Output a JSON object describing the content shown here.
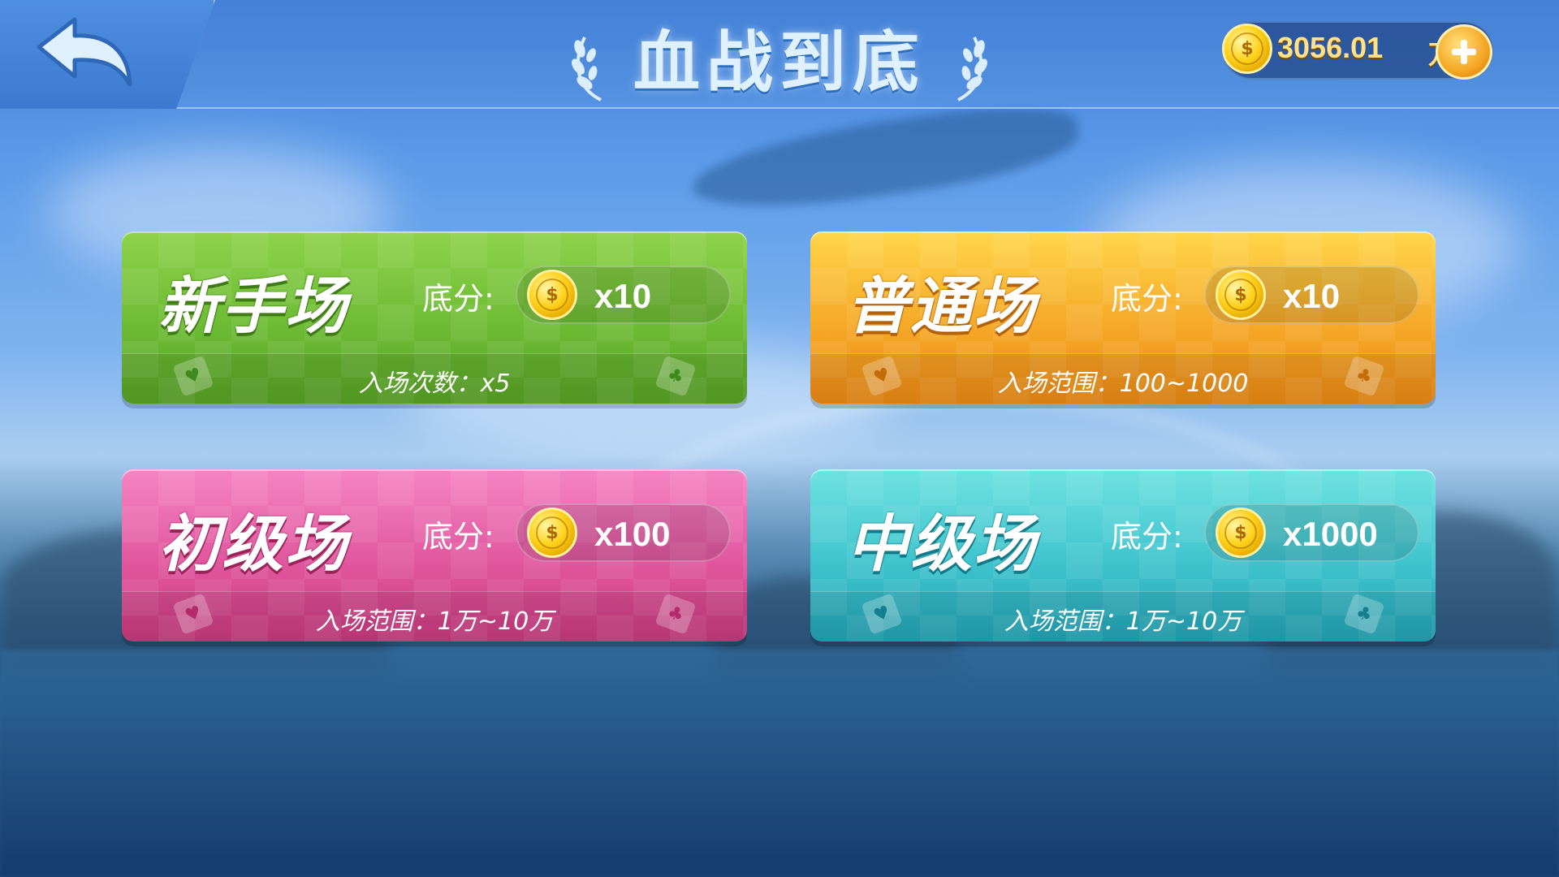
{
  "header": {
    "title": "血战到底",
    "back_label": "back",
    "coins": {
      "value": "3056.01",
      "unit": "万"
    },
    "add_label": "+"
  },
  "rooms": [
    {
      "name": "新手场",
      "base_label": "底分:",
      "base_value": "x10",
      "info": "入场次数：x5",
      "color": "#6dbb34"
    },
    {
      "name": "普通场",
      "base_label": "底分:",
      "base_value": "x10",
      "info": "入场范围：100~1000",
      "color": "#f5a828"
    },
    {
      "name": "初级场",
      "base_label": "底分:",
      "base_value": "x100",
      "info": "入场范围：1万~10万",
      "color": "#e0569e"
    },
    {
      "name": "中级场",
      "base_label": "底分:",
      "base_value": "x1000",
      "info": "入场范围：1万~10万",
      "color": "#3ec3cd"
    }
  ],
  "icons": {
    "back": "back-arrow-icon",
    "coin": "gold-coin-icon",
    "add": "plus-icon",
    "suit_left": "heart-card-icon",
    "suit_right": "club-card-icon",
    "laurel": "laurel-icon"
  }
}
